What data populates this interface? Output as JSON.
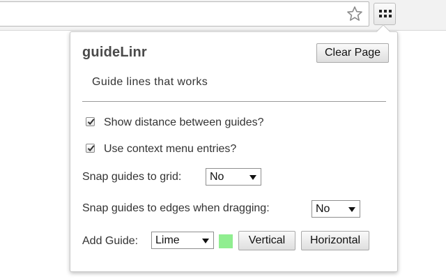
{
  "browser": {
    "bookmark_icon": "star-icon",
    "extension_icon": "grid-dots-icon"
  },
  "popup": {
    "title": "guideLinr",
    "clear_button": "Clear Page",
    "subtitle": "Guide lines that works",
    "options": {
      "show_distance": {
        "label": "Show distance between guides?",
        "checked": true
      },
      "context_menu": {
        "label": "Use context menu entries?",
        "checked": true
      }
    },
    "snap_grid": {
      "label": "Snap guides to grid:",
      "value": "No"
    },
    "snap_edges": {
      "label": "Snap guides to edges when dragging:",
      "value": "No"
    },
    "add_guide": {
      "label": "Add Guide:",
      "color_value": "Lime",
      "swatch_color": "#90ee90",
      "vertical_button": "Vertical",
      "horizontal_button": "Horizontal"
    }
  }
}
